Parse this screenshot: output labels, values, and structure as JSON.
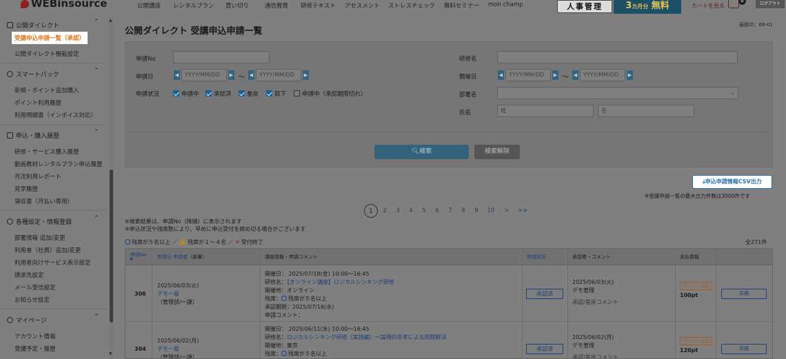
{
  "header": {
    "logo": "WEBinsource",
    "nav": [
      "公開講座",
      "レンタルプラン",
      "買い切り",
      "通信教育",
      "研修テキスト",
      "アセスメント",
      "ストレスチェック",
      "無料セミナー",
      "mon champ"
    ],
    "jinji": "人事管理",
    "free_banner_big": "3",
    "free_banner_small": "カ月分",
    "free_banner_tail": "無料",
    "cart_label": "カートを見る",
    "cart_count": "0",
    "logout": "ログアウト"
  },
  "sidebar": {
    "sections": [
      {
        "title": "公開ダイレクト",
        "items": [
          "受講申込申請一覧（承認）",
          "公開ダイレクト機能設定"
        ]
      },
      {
        "title": "スマートパック",
        "items": [
          "新規・ポイント追加購入",
          "ポイント利用履歴",
          "利用明細書（インボイス対応）"
        ]
      },
      {
        "title": "申込・購入履歴",
        "items": [
          "研修・サービス購入履歴",
          "動画教材レンタルプラン申込履歴",
          "月次利用レポート",
          "見学履歴",
          "領収書（月払い専用）"
        ]
      },
      {
        "title": "各種設定・情報登録",
        "items": [
          "部署情報 追加/変更",
          "利用者（社員）追加/変更",
          "利用者向けサービス表示設定",
          "請求先設定",
          "メール受信設定",
          "お知らせ設定"
        ]
      },
      {
        "title": "マイページ",
        "items": [
          "アカウント情報",
          "受講予定・履歴"
        ]
      }
    ]
  },
  "main": {
    "page_id": "画面ID：68-01",
    "title": "公開ダイレクト 受講申込申請一覧",
    "form": {
      "app_no_label": "申請No",
      "training_label": "研修名",
      "app_date_label": "申請日",
      "date_placeholder": "YYYY/MM/DD",
      "tilde": "～",
      "held_date_label": "開催日",
      "status_label": "申請状況",
      "statuses": [
        {
          "label": "申請中",
          "checked": true
        },
        {
          "label": "承認済",
          "checked": true
        },
        {
          "label": "差戻",
          "checked": true
        },
        {
          "label": "取下",
          "checked": true
        },
        {
          "label": "申請中（承認期限切れ）",
          "checked": false
        }
      ],
      "dept_label": "部署名",
      "name_label": "氏名",
      "last_name_placeholder": "姓",
      "first_name_placeholder": "名",
      "search_button": "検索",
      "clear_button": "検索解除"
    },
    "csv_button": "申込申請情報CSV出力",
    "csv_note": "※受講申請一覧の最大出力件数は3000件です",
    "pagination": [
      "1",
      "2",
      "3",
      "4",
      "5",
      "6",
      "7",
      "8",
      "9",
      "10",
      ">",
      ">>"
    ],
    "notes": [
      "※検索結果は、申請No（降順）に表示されます",
      "※申込状況や残席数により、早めに申込受付を締め切る場合がございます"
    ],
    "legend": {
      "circle": "残席が５名以上",
      "triangle": "残席が１～４名",
      "cross": "受付終了",
      "slash": "／"
    },
    "total": "全271件",
    "table": {
      "headers": {
        "no": "申請No",
        "date_applicant_a": "申請日",
        "date_applicant_b": "申請者",
        "date_applicant_c": "（部署）",
        "course": "講座情報・申請コメント",
        "status": "申請状況",
        "approver": "承認者・コメント",
        "payment": "支払情報"
      },
      "rows": [
        {
          "no": "306",
          "date": "2025/06/03(火)",
          "applicant": "デモ一般",
          "dept": "（管理部/一課）",
          "held": "開催日：  2025/07/18(金) 10:00～16:45",
          "training_prefix": "研修名：",
          "training": "【オンライン講座】ロジカルシンキング研修",
          "venue": "開催地：オンライン",
          "seats_prefix": "残席：",
          "seats": "残席が５名以上",
          "deadline": "承認期限：2025/07/16(水)",
          "comment": "申請コメント：",
          "status": "承認済",
          "approve_date": "2025/06/03(火)",
          "approver": "デモ管理",
          "approve_comment": "承認/差戻コメント",
          "pay_badge": "ポイント支払",
          "points": "100pt",
          "detail": "詳細"
        },
        {
          "no": "304",
          "date": "2025/06/02(月)",
          "applicant": "デモ一般",
          "dept": "（管理部/一課）",
          "held": "開催日：  2025/06/11(水) 10:00～16:45",
          "training_prefix": "研修名：",
          "training": "ロジカルシンキング研修（実践編）～論理的思考による問題解決",
          "venue": "開催地：東京",
          "seats_prefix": "残席：",
          "seats": "残席が５名以上",
          "status": "承認済",
          "approve_date": "2025/06/02(月)",
          "approver": "デモ管理",
          "approve_comment": "承認/差戻コメント",
          "pay_badge": "ポイント支払",
          "points": "120pt",
          "detail": "詳細"
        }
      ]
    }
  }
}
